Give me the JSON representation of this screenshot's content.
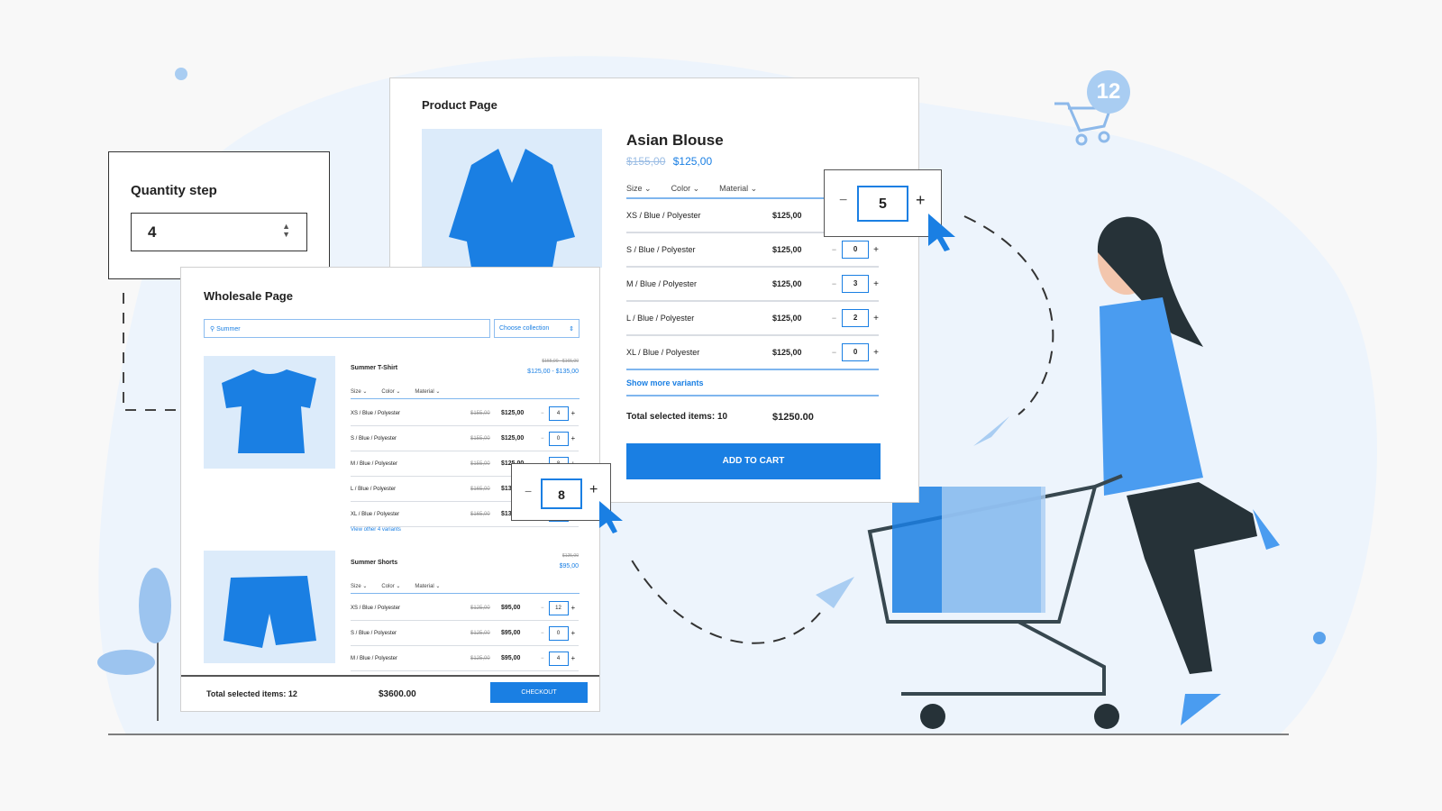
{
  "colors": {
    "accent": "#1a7fe3",
    "background": "#f8f8f8",
    "light_blue": "#dcebfa"
  },
  "cart_badge": "12",
  "quantity_step": {
    "title": "Quantity step",
    "value": "4"
  },
  "product_page": {
    "header": "Product Page",
    "product_name": "Asian Blouse",
    "old_price": "$155,00",
    "price": "$125,00",
    "filters": [
      "Size",
      "Color",
      "Material"
    ],
    "variants": [
      {
        "name": "XS / Blue / Polyester",
        "price": "$125,00",
        "qty": "5"
      },
      {
        "name": "S / Blue / Polyester",
        "price": "$125,00",
        "qty": "0"
      },
      {
        "name": "M / Blue / Polyester",
        "price": "$125,00",
        "qty": "3"
      },
      {
        "name": "L / Blue / Polyester",
        "price": "$125,00",
        "qty": "2"
      },
      {
        "name": "XL / Blue / Polyester",
        "price": "$125,00",
        "qty": "0"
      }
    ],
    "show_more": "Show more variants",
    "total_label": "Total selected items: 10",
    "total": "$1250.00",
    "add_to_cart": "ADD TO CART"
  },
  "wholesale_page": {
    "header": "Wholesale Page",
    "search_value": "Summer",
    "collection_placeholder": "Choose collection",
    "products": [
      {
        "name": "Summer T-Shirt",
        "old_price": "$155,00 - $165,00",
        "price": "$125,00 - $135,00",
        "filters": [
          "Size",
          "Color",
          "Material"
        ],
        "variants": [
          {
            "name": "XS / Blue / Polyester",
            "old": "$155,00",
            "price": "$125,00",
            "qty": "4"
          },
          {
            "name": "S / Blue / Polyester",
            "old": "$155,00",
            "price": "$125,00",
            "qty": "0"
          },
          {
            "name": "M / Blue / Polyester",
            "old": "$155,00",
            "price": "$125,00",
            "qty": "8"
          },
          {
            "name": "L / Blue / Polyester",
            "old": "$165,00",
            "price": "$135,00",
            "qty": ""
          },
          {
            "name": "XL / Blue / Polyester",
            "old": "$165,00",
            "price": "$135,00",
            "qty": ""
          }
        ],
        "more": "View other 4 variants"
      },
      {
        "name": "Summer Shorts",
        "old_price": "$125,00",
        "price": "$95,00",
        "filters": [
          "Size",
          "Color",
          "Material"
        ],
        "variants": [
          {
            "name": "XS / Blue / Polyester",
            "old": "$125,00",
            "price": "$95,00",
            "qty": "12"
          },
          {
            "name": "S / Blue / Polyester",
            "old": "$125,00",
            "price": "$95,00",
            "qty": "0"
          },
          {
            "name": "M / Blue / Polyester",
            "old": "$125,00",
            "price": "$95,00",
            "qty": "4"
          }
        ]
      }
    ],
    "total_label": "Total selected items: 12",
    "total": "$3600.00",
    "checkout": "CHECKOUT"
  },
  "popup_stepper_product": {
    "value": "5",
    "minus": "−",
    "plus": "+"
  },
  "popup_stepper_wholesale": {
    "value": "8",
    "minus": "−",
    "plus": "+"
  }
}
